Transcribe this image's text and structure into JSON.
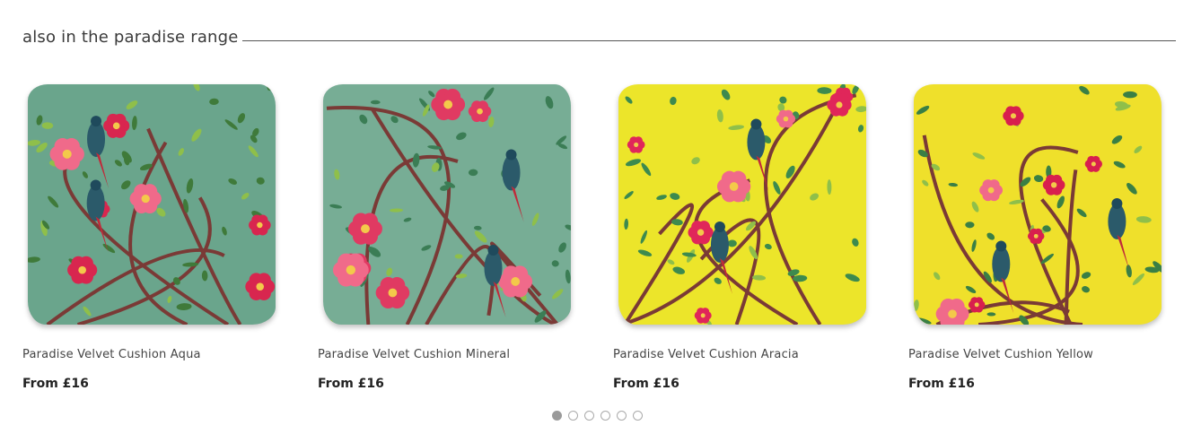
{
  "section": {
    "title": "also in the paradise range"
  },
  "products": [
    {
      "name": "Paradise Velvet Cushion Aqua",
      "price": "From £16",
      "bg": "#6aa58c",
      "accent": "#d8264f",
      "leaf": "#3f7a3a"
    },
    {
      "name": "Paradise Velvet Cushion Mineral",
      "price": "From £16",
      "bg": "#77ad95",
      "accent": "#e03a62",
      "leaf": "#3b7d55"
    },
    {
      "name": "Paradise Velvet Cushion Aracia",
      "price": "From £16",
      "bg": "#ece52a",
      "accent": "#e0265a",
      "leaf": "#3d8a4e"
    },
    {
      "name": "Paradise Velvet Cushion Yellow",
      "price": "From £16",
      "bg": "#efe02b",
      "accent": "#d81f4e",
      "leaf": "#3a7f45"
    }
  ],
  "pagination": {
    "count": 6,
    "active": 0
  }
}
